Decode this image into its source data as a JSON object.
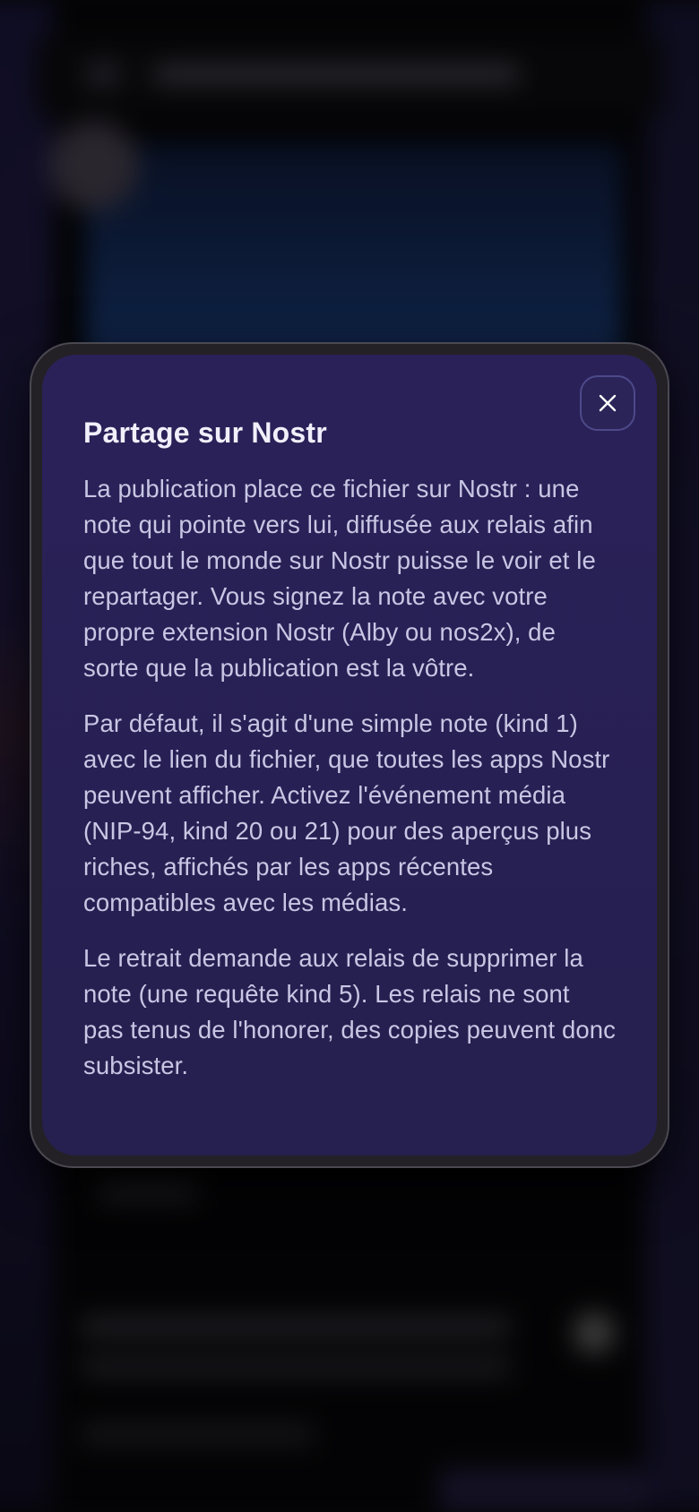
{
  "modal": {
    "title": "Partage sur Nostr",
    "close_icon": "close-icon",
    "paragraphs": [
      "La publication place ce fichier sur Nostr : une note qui pointe vers lui, diffusée aux relais afin que tout le monde sur Nostr puisse le voir et le repartager. Vous signez la note avec votre propre extension Nostr (Alby ou nos2x), de sorte que la publication est la vôtre.",
      "Par défaut, il s'agit d'une simple note (kind 1) avec le lien du fichier, que toutes les apps Nostr peuvent afficher. Activez l'événement média (NIP-94, kind 20 ou 21) pour des aperçus plus riches, affichés par les apps récentes compatibles avec les médias.",
      "Le retrait demande aux relais de supprimer la note (une requête kind 5). Les relais ne sont pas tenus de l'honorer, des copies peuvent donc subsister."
    ]
  },
  "colors": {
    "modal_background": "#2a2159",
    "title_text": "#f1effa",
    "body_text": "#c9c6e4",
    "close_border": "#4d4a8a"
  }
}
